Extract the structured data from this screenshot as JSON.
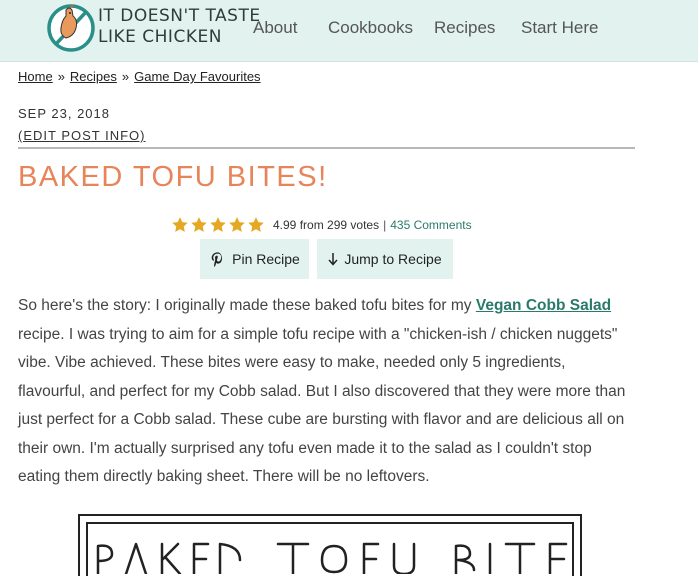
{
  "site": {
    "logo_line1": "IT DOESN'T TASTE",
    "logo_line2": "LIKE CHICKEN",
    "nav": [
      "About",
      "Cookbooks",
      "Recipes",
      "Start Here"
    ]
  },
  "breadcrumb": {
    "items": [
      "Home",
      "Recipes",
      "Game Day Favourites"
    ],
    "separator": "»"
  },
  "post": {
    "date": "SEP 23, 2018",
    "edit_link": "(EDIT POST INFO)",
    "title": "BAKED TOFU BITES!"
  },
  "rating": {
    "stars": 5,
    "value_text": "4.99",
    "from_text": "from",
    "votes_text": "299 votes",
    "divider": "|",
    "comments_link": "435 Comments",
    "star_color": "#e5a823"
  },
  "buttons": {
    "pin_label": "Pin Recipe",
    "jump_label": "Jump to Recipe",
    "pin_icon": "pinterest-icon",
    "jump_icon": "arrow-down-icon"
  },
  "intro": {
    "before_link": "So here's the story: I originally made these baked tofu bites for my ",
    "link_text": "Vegan Cobb Salad",
    "after_link": " recipe. I was trying to aim for a simple tofu recipe with a \"chicken-ish / chicken nuggets\" vibe. Vibe achieved. These bites were easy to make, needed only 5 ingredients, flavourful, and perfect for my Cobb salad. But I also discovered that they were more than just perfect for a Cobb salad. These cube are bursting with flavor and are delicious all on their own. I'm actually surprised any tofu even made it to the salad as I couldn't stop eating them directly baking sheet. There will be no leftovers."
  },
  "hero": {
    "title_text": "BAKED TOFU BITES"
  },
  "colors": {
    "header_bg": "#e2f3ef",
    "title": "#e8845a",
    "link": "#2a7a6a",
    "button_bg": "#e2f3ef"
  }
}
